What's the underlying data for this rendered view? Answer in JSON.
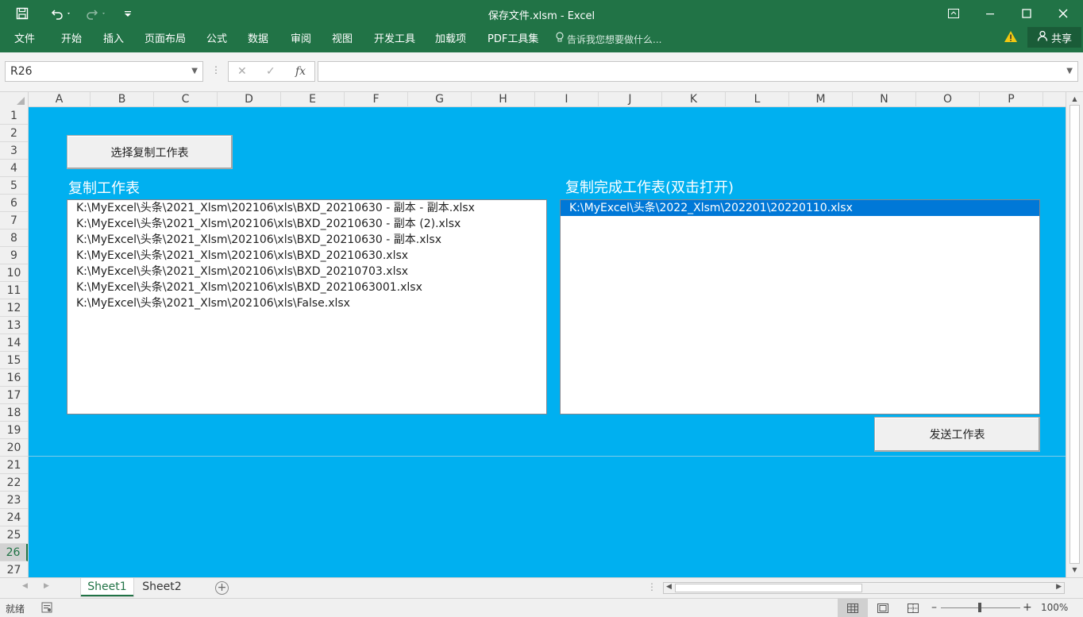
{
  "window": {
    "title": "保存文件.xlsm - Excel"
  },
  "ribbon": {
    "tabs": [
      "文件",
      "开始",
      "插入",
      "页面布局",
      "公式",
      "数据",
      "审阅",
      "视图",
      "开发工具",
      "加载项",
      "PDF工具集"
    ],
    "tell_me": "告诉我您想要做什么...",
    "share": "共享"
  },
  "formula_bar": {
    "name_box": "R26",
    "fx_label": "fx",
    "formula": ""
  },
  "grid": {
    "columns": [
      "A",
      "B",
      "C",
      "D",
      "E",
      "F",
      "G",
      "H",
      "I",
      "J",
      "K",
      "L",
      "M",
      "N",
      "O",
      "P"
    ],
    "rows": [
      "1",
      "2",
      "3",
      "4",
      "5",
      "6",
      "7",
      "8",
      "9",
      "10",
      "11",
      "12",
      "13",
      "14",
      "15",
      "16",
      "17",
      "18",
      "19",
      "20",
      "21",
      "22",
      "23",
      "24",
      "25",
      "26",
      "27"
    ],
    "active_row": "26",
    "background_color": "#00b0f0"
  },
  "form": {
    "select_button": "选择复制工作表",
    "left_label": "复制工作表",
    "left_list": [
      "K:\\MyExcel\\头条\\2021_Xlsm\\202106\\xls\\BXD_20210630 - 副本 - 副本.xlsx",
      "K:\\MyExcel\\头条\\2021_Xlsm\\202106\\xls\\BXD_20210630 - 副本 (2).xlsx",
      "K:\\MyExcel\\头条\\2021_Xlsm\\202106\\xls\\BXD_20210630 - 副本.xlsx",
      "K:\\MyExcel\\头条\\2021_Xlsm\\202106\\xls\\BXD_20210630.xlsx",
      "K:\\MyExcel\\头条\\2021_Xlsm\\202106\\xls\\BXD_20210703.xlsx",
      "K:\\MyExcel\\头条\\2021_Xlsm\\202106\\xls\\BXD_2021063001.xlsx",
      "K:\\MyExcel\\头条\\2021_Xlsm\\202106\\xls\\False.xlsx"
    ],
    "right_label": "复制完成工作表(双击打开)",
    "right_list": [
      "K:\\MyExcel\\头条\\2022_Xlsm\\202201\\20220110.xlsx"
    ],
    "send_button": "发送工作表"
  },
  "sheet_tabs": {
    "tabs": [
      "Sheet1",
      "Sheet2"
    ],
    "active": "Sheet1"
  },
  "status_bar": {
    "ready": "就绪",
    "zoom": "100%"
  }
}
